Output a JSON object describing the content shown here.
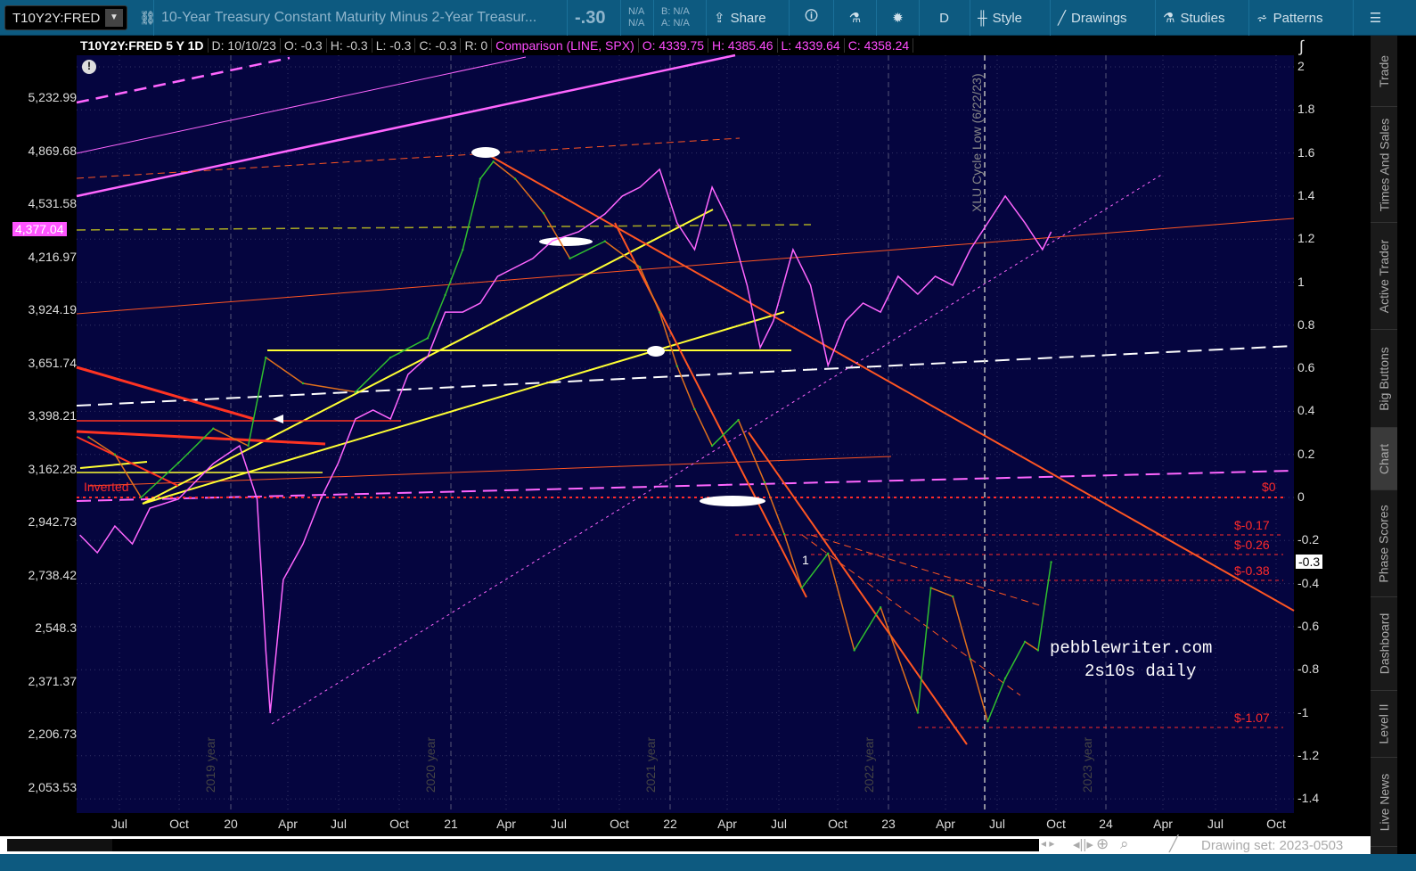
{
  "toolbar": {
    "symbol": "T10Y2Y:FRED",
    "description": "10-Year Treasury Constant Maturity Minus 2-Year Treasur...",
    "last": "-.30",
    "na1": "N/A",
    "na2": "N/A",
    "bid": "B: N/A",
    "ask": "A: N/A",
    "share": "Share",
    "period": "D",
    "style": "Style",
    "drawings": "Drawings",
    "studies": "Studies",
    "patterns": "Patterns"
  },
  "info": {
    "title": "T10Y2Y:FRED 5 Y 1D",
    "date": "D: 10/10/23",
    "open": "O: -0.3",
    "high": "H: -0.3",
    "low": "L: -0.3",
    "close": "C: -0.3",
    "r": "R: 0",
    "comparison": "Comparison (LINE, SPX)",
    "c_open": "O: 4339.75",
    "c_high": "H: 4385.46",
    "c_low": "L: 4339.64",
    "c_close": "C: 4358.24"
  },
  "badges": {
    "spx_price": "4,377.04",
    "spread_price": "-0.3"
  },
  "annotations": {
    "zero": "$0",
    "l017": "$-0.17",
    "l026": "$-0.26",
    "l038": "$-0.38",
    "l107": "$-1.07",
    "inverted": "Inverted",
    "site": "pebblewriter.com",
    "subtitle": "2s10s daily",
    "xlu": "XLU Cycle Low (6/22/23)",
    "marker1": "1",
    "y2019": "2019 year",
    "y2020": "2020 year",
    "y2021": "2021 year",
    "y2022": "2022 year",
    "y2023": "2023 year"
  },
  "bottom": {
    "drawing_set": "Drawing set: 2023-0503"
  },
  "side_tabs": [
    "Trade",
    "Times And Sales",
    "Active Trader",
    "Big Buttons",
    "Chart",
    "Phase Scores",
    "Dashboard",
    "Level II",
    "Live News"
  ],
  "colors": {
    "background": "#05053f",
    "spread_up": "#2fbf2f",
    "spread_down": "#e0701c",
    "spx": "#ff66ff",
    "accent": "#ff2a2a"
  },
  "chart_data": {
    "type": "line",
    "title": "T10Y2Y:FRED 5 Y 1D",
    "x_ticks": [
      "Jul",
      "Oct",
      "20",
      "Apr",
      "Jul",
      "Oct",
      "21",
      "Apr",
      "Jul",
      "Oct",
      "22",
      "Apr",
      "Jul",
      "Oct",
      "23",
      "Apr",
      "Jul",
      "Oct",
      "24",
      "Apr",
      "Jul",
      "Oct"
    ],
    "y_right_ticks": [
      "2",
      "1.8",
      "1.6",
      "1.4",
      "1.2",
      "1",
      "0.8",
      "0.6",
      "0.4",
      "0.2",
      "0",
      "-0.2",
      "-0.4",
      "-0.6",
      "-0.8",
      "-1",
      "-1.2",
      "-1.4"
    ],
    "y_left_ticks": [
      "5,232.99",
      "4,869.68",
      "4,531.58",
      "4,216.97",
      "3,924.19",
      "3,651.74",
      "3,398.21",
      "3,162.28",
      "2,942.73",
      "2,738.42",
      "2,548.3",
      "2,371.37",
      "2,206.73",
      "2,053.53"
    ],
    "ylim_right": [
      -1.45,
      2.05
    ],
    "ylim_left_log": [
      2000,
      5450
    ],
    "series": [
      {
        "name": "T10Y2Y spread",
        "axis": "right",
        "points": [
          [
            2019.35,
            0.28
          ],
          [
            2019.47,
            0.2
          ],
          [
            2019.59,
            0.0
          ],
          [
            2019.76,
            0.16
          ],
          [
            2019.92,
            0.32
          ],
          [
            2020.08,
            0.24
          ],
          [
            2020.16,
            0.65
          ],
          [
            2020.33,
            0.53
          ],
          [
            2020.57,
            0.49
          ],
          [
            2020.73,
            0.65
          ],
          [
            2020.9,
            0.74
          ],
          [
            2020.98,
            0.94
          ],
          [
            2021.06,
            1.15
          ],
          [
            2021.14,
            1.48
          ],
          [
            2021.2,
            1.56
          ],
          [
            2021.3,
            1.48
          ],
          [
            2021.43,
            1.32
          ],
          [
            2021.55,
            1.11
          ],
          [
            2021.71,
            1.19
          ],
          [
            2021.87,
            1.07
          ],
          [
            2021.96,
            0.86
          ],
          [
            2022.04,
            0.61
          ],
          [
            2022.12,
            0.41
          ],
          [
            2022.2,
            0.24
          ],
          [
            2022.32,
            0.36
          ],
          [
            2022.44,
            0.07
          ],
          [
            2022.53,
            -0.17
          ],
          [
            2022.61,
            -0.42
          ],
          [
            2022.73,
            -0.26
          ],
          [
            2022.85,
            -0.71
          ],
          [
            2022.97,
            -0.51
          ],
          [
            2023.14,
            -1.0
          ],
          [
            2023.2,
            -0.42
          ],
          [
            2023.3,
            -0.46
          ],
          [
            2023.38,
            -0.75
          ],
          [
            2023.46,
            -1.04
          ],
          [
            2023.54,
            -0.84
          ],
          [
            2023.63,
            -0.67
          ],
          [
            2023.69,
            -0.71
          ],
          [
            2023.75,
            -0.3
          ]
        ]
      },
      {
        "name": "SPX",
        "axis": "left",
        "points": [
          [
            2019.31,
            2894
          ],
          [
            2019.39,
            2825
          ],
          [
            2019.47,
            2929
          ],
          [
            2019.55,
            2859
          ],
          [
            2019.63,
            3001
          ],
          [
            2019.76,
            3038
          ],
          [
            2019.92,
            3188
          ],
          [
            2020.04,
            3266
          ],
          [
            2020.12,
            3038
          ],
          [
            2020.16,
            2474
          ],
          [
            2020.18,
            2273
          ],
          [
            2020.24,
            2724
          ],
          [
            2020.33,
            2859
          ],
          [
            2020.41,
            3038
          ],
          [
            2020.49,
            3188
          ],
          [
            2020.57,
            3387
          ],
          [
            2020.65,
            3428
          ],
          [
            2020.73,
            3387
          ],
          [
            2020.81,
            3598
          ],
          [
            2020.9,
            3686
          ],
          [
            2020.98,
            3915
          ],
          [
            2021.06,
            3915
          ],
          [
            2021.14,
            3963
          ],
          [
            2021.22,
            4110
          ],
          [
            2021.3,
            4159
          ],
          [
            2021.38,
            4210
          ],
          [
            2021.47,
            4313
          ],
          [
            2021.59,
            4365
          ],
          [
            2021.71,
            4472
          ],
          [
            2021.79,
            4582
          ],
          [
            2021.87,
            4637
          ],
          [
            2021.96,
            4751
          ],
          [
            2022.04,
            4418
          ],
          [
            2022.12,
            4261
          ],
          [
            2022.2,
            4637
          ],
          [
            2022.28,
            4418
          ],
          [
            2022.36,
            4060
          ],
          [
            2022.42,
            3731
          ],
          [
            2022.48,
            3868
          ],
          [
            2022.57,
            4261
          ],
          [
            2022.65,
            4060
          ],
          [
            2022.73,
            3642
          ],
          [
            2022.81,
            3868
          ],
          [
            2022.89,
            3963
          ],
          [
            2022.97,
            3915
          ],
          [
            2023.05,
            4110
          ],
          [
            2023.14,
            4011
          ],
          [
            2023.22,
            4110
          ],
          [
            2023.3,
            4060
          ],
          [
            2023.38,
            4261
          ],
          [
            2023.46,
            4418
          ],
          [
            2023.54,
            4582
          ],
          [
            2023.63,
            4418
          ],
          [
            2023.71,
            4261
          ],
          [
            2023.75,
            4365
          ]
        ]
      }
    ]
  }
}
